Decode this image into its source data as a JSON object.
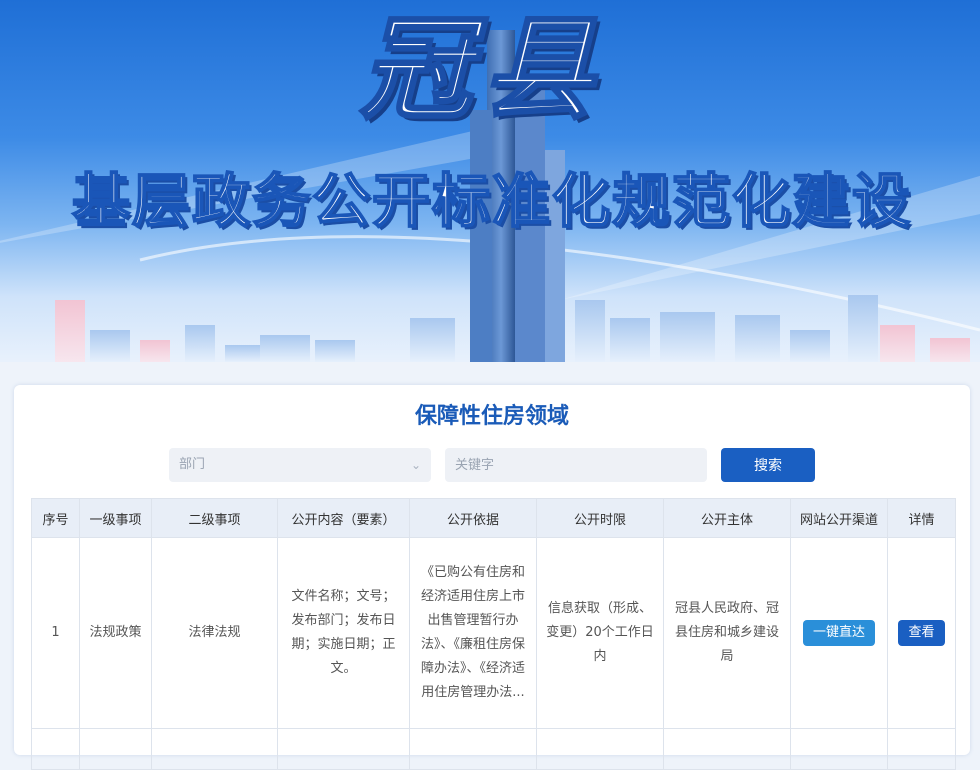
{
  "banner": {
    "county_name": "冠县",
    "subtitle": "基层政务公开标准化规范化建设"
  },
  "page": {
    "title": "保障性住房领域"
  },
  "search": {
    "department_placeholder": "部门",
    "keyword_placeholder": "关键字",
    "button_label": "搜索"
  },
  "table": {
    "headers": [
      "序号",
      "一级事项",
      "二级事项",
      "公开内容（要素）",
      "公开依据",
      "公开时限",
      "公开主体",
      "网站公开渠道",
      "详情"
    ],
    "rows": [
      {
        "index": "1",
        "level1": "法规政策",
        "level2": "法律法规",
        "content": "文件名称；文号；发布部门；发布日期；实施日期；正文。",
        "basis": "《已购公有住房和经济适用住房上市出售管理暂行办法》、《廉租住房保障办法》、《经济适用住房管理办法...",
        "deadline": "信息获取（形成、变更）20个工作日内",
        "subject": "冠县人民政府、冠县住房和城乡建设局",
        "channel_label": "一键直达",
        "detail_label": "查看"
      }
    ]
  },
  "colors": {
    "accent": "#1a5fc2",
    "title": "#1a5bb8",
    "direct_button": "#2a8fd9",
    "header_bg": "#e8eef7"
  }
}
